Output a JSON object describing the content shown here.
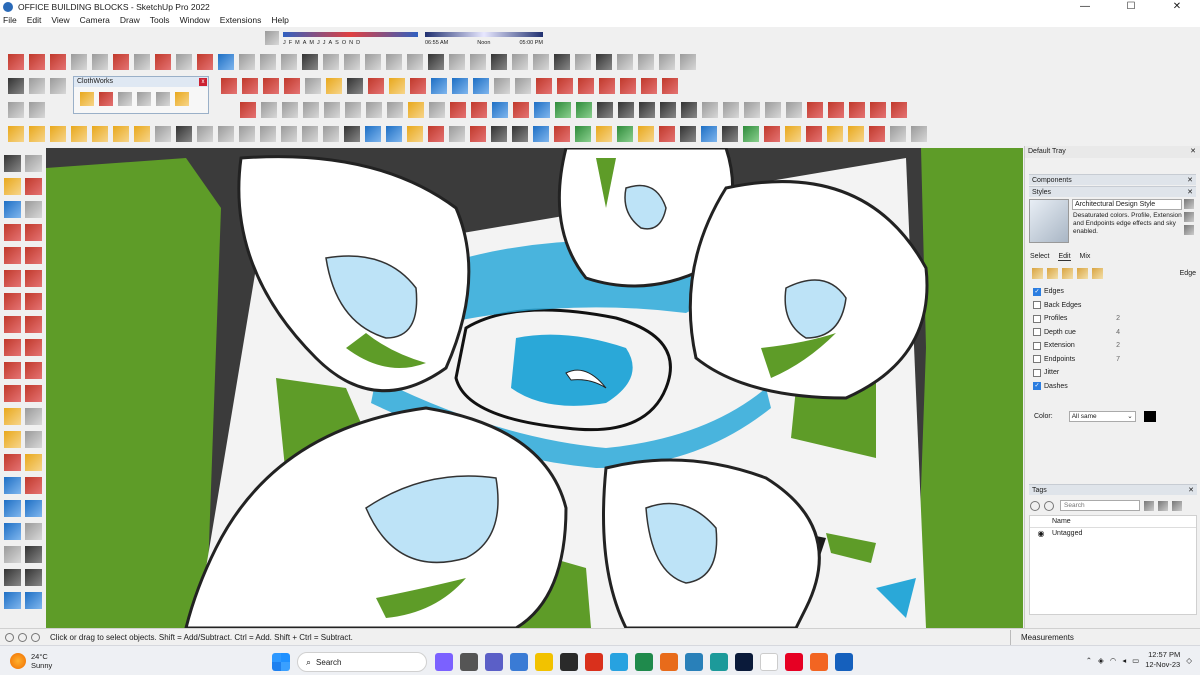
{
  "window": {
    "title": "OFFICE BUILDING BLOCKS - SketchUp Pro 2022",
    "minimize": "—",
    "maximize": "☐",
    "close": "✕"
  },
  "menu": [
    "File",
    "Edit",
    "View",
    "Camera",
    "Draw",
    "Tools",
    "Window",
    "Extensions",
    "Help"
  ],
  "shadow": {
    "months": [
      "J",
      "F",
      "M",
      "A",
      "M",
      "J",
      "J",
      "A",
      "S",
      "O",
      "N",
      "D"
    ],
    "time_start": "06:55 AM",
    "time_noon": "Noon",
    "time_end": "05:00 PM"
  },
  "clothworks": {
    "title": "ClothWorks",
    "close": "x"
  },
  "tray": {
    "title": "Default Tray",
    "sections": {
      "components": "Components",
      "styles": "Styles",
      "tags": "Tags"
    },
    "style": {
      "name": "Architectural Design Style",
      "description": "Desaturated colors. Profile, Extension and Endpoints edge effects and sky enabled."
    },
    "tabs": [
      "Select",
      "Edit",
      "Mix"
    ],
    "edit_label": "Edge",
    "edges": [
      {
        "label": "Edges",
        "checked": true,
        "value": ""
      },
      {
        "label": "Back Edges",
        "checked": false,
        "value": ""
      },
      {
        "label": "Profiles",
        "checked": false,
        "value": "2"
      },
      {
        "label": "Depth cue",
        "checked": false,
        "value": "4"
      },
      {
        "label": "Extension",
        "checked": false,
        "value": "2"
      },
      {
        "label": "Endpoints",
        "checked": false,
        "value": "7"
      },
      {
        "label": "Jitter",
        "checked": false,
        "value": ""
      },
      {
        "label": "Dashes",
        "checked": true,
        "value": ""
      }
    ],
    "color_label": "Color:",
    "color_select": "All same",
    "color_swatch": "#000000",
    "tags_search_placeholder": "Search",
    "tags_column": "Name",
    "tags_rows": [
      "Untagged"
    ]
  },
  "status": {
    "message": "Click or drag to select objects. Shift = Add/Subtract. Ctrl = Add. Shift + Ctrl = Subtract.",
    "measurements": "Measurements"
  },
  "taskbar": {
    "weather_temp": "24°C",
    "weather_desc": "Sunny",
    "search": "Search",
    "time": "12:57 PM",
    "date": "12-Nov-23"
  },
  "colors": {
    "accent": "#2b7de0",
    "grass": "#5e9c28",
    "water": "#2aa8d8",
    "building": "#ffffff"
  }
}
